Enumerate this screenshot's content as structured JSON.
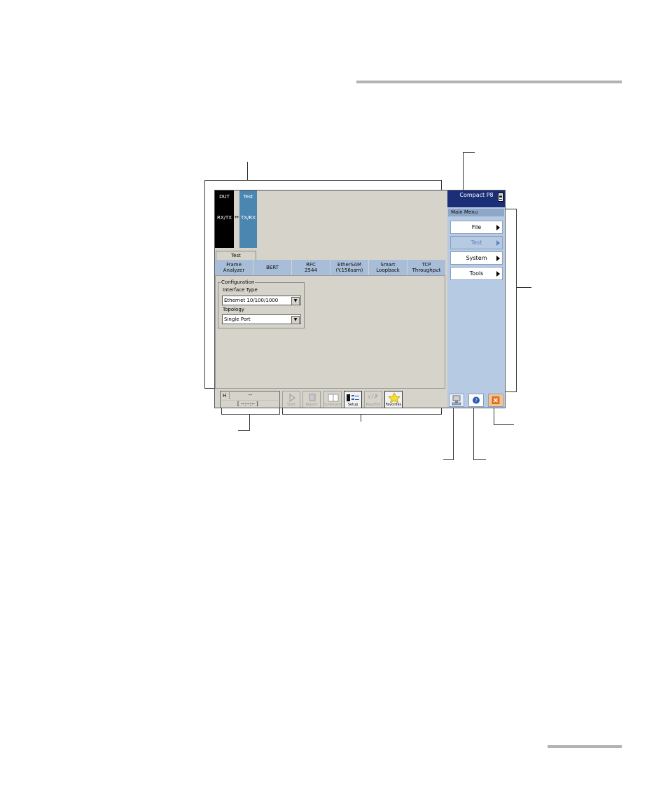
{
  "app_title": "Compact P8",
  "ports": {
    "dut_label": "DUT",
    "dut_mode": "RX/TX",
    "test_label": "Test",
    "test_mode": "TX/RX"
  },
  "main_tab": "Test",
  "test_tabs": [
    {
      "line1": "Frame",
      "line2": "Analyzer"
    },
    {
      "line1": "BERT",
      "line2": ""
    },
    {
      "line1": "RFC",
      "line2": "2544"
    },
    {
      "line1": "EtherSAM",
      "line2": "(Y.156sam)"
    },
    {
      "line1": "Smart",
      "line2": "Loopback"
    },
    {
      "line1": "TCP",
      "line2": "Throughput"
    }
  ],
  "configuration": {
    "legend": "Configuration",
    "interface_type_label": "Interface Type",
    "interface_type_value": "Ethernet 10/100/1000",
    "topology_label": "Topology",
    "topology_value": "Single Port"
  },
  "main_menu": {
    "title": "Main Menu",
    "items": [
      {
        "label": "File",
        "enabled": true
      },
      {
        "label": "Test",
        "enabled": false
      },
      {
        "label": "System",
        "enabled": true
      },
      {
        "label": "Tools",
        "enabled": true
      }
    ]
  },
  "timer": {
    "prefix": "H",
    "value": "--",
    "elapsed": "[ --:--:-- ]"
  },
  "toolbar": {
    "start": "Start",
    "report": "Report",
    "summary": "Summary",
    "setup": "Setup",
    "pass_fail": "Pass/Fail",
    "favorites": "Favorites"
  },
  "icons": [
    "battery-icon",
    "swap-arrow-icon",
    "start-icon",
    "report-icon",
    "summary-icon",
    "setup-icon",
    "pass-fail-icon",
    "favorites-star-icon",
    "instrument-icon",
    "help-icon",
    "close-icon"
  ],
  "colors": {
    "title_bar": "#1a2f78",
    "menu_bg": "#b7cae4",
    "test_port": "#4a86b0",
    "close_button": "#f0a050"
  }
}
